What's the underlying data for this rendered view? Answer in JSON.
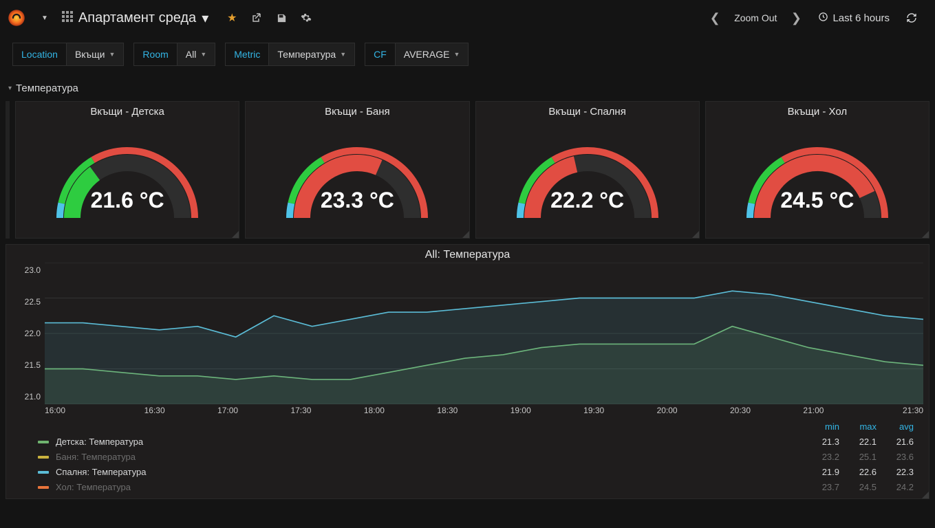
{
  "header": {
    "dashboard_title": "Апартамент среда",
    "zoom_out": "Zoom Out",
    "time_range": "Last 6 hours"
  },
  "variables": [
    {
      "label": "Location",
      "value": "Вкъщи"
    },
    {
      "label": "Room",
      "value": "All"
    },
    {
      "label": "Metric",
      "value": "Температура"
    },
    {
      "label": "CF",
      "value": "AVERAGE"
    }
  ],
  "row_title": "Температура",
  "gauges": [
    {
      "title": "Вкъщи - Детска",
      "value": "21.6 °C",
      "frac": 0.3
    },
    {
      "title": "Вкъщи - Баня",
      "value": "23.3 °C",
      "frac": 0.63
    },
    {
      "title": "Вкъщи - Спалня",
      "value": "22.2 °C",
      "frac": 0.43
    },
    {
      "title": "Вкъщи - Хол",
      "value": "24.5 °C",
      "frac": 0.86
    }
  ],
  "gauge_zones": [
    {
      "from": 0.0,
      "to": 0.07,
      "color": "#4fc3e8"
    },
    {
      "from": 0.07,
      "to": 0.33,
      "color": "#2ecc40"
    },
    {
      "from": 0.33,
      "to": 1.0,
      "color": "#e14d42"
    }
  ],
  "chart_data": {
    "type": "line",
    "title": "All: Температура",
    "xlabel": "",
    "ylabel": "",
    "ylim": [
      21.0,
      23.0
    ],
    "x_ticks": [
      "16:00",
      "16:30",
      "17:00",
      "17:30",
      "18:00",
      "18:30",
      "19:00",
      "19:30",
      "20:00",
      "20:30",
      "21:00",
      "21:30"
    ],
    "y_ticks": [
      "23.0",
      "22.5",
      "22.0",
      "21.5",
      "21.0"
    ],
    "series": [
      {
        "name": "Детска: Температура",
        "color": "#6fb36f",
        "active": true,
        "min": 21.3,
        "max": 22.1,
        "avg": 21.6,
        "values": [
          21.5,
          21.5,
          21.45,
          21.4,
          21.4,
          21.35,
          21.4,
          21.35,
          21.35,
          21.45,
          21.55,
          21.65,
          21.7,
          21.8,
          21.85,
          21.85,
          21.85,
          21.85,
          22.1,
          21.95,
          21.8,
          21.7,
          21.6,
          21.55
        ]
      },
      {
        "name": "Баня: Температура",
        "color": "#c9b23e",
        "active": false,
        "min": 23.2,
        "max": 25.1,
        "avg": 23.6,
        "values": []
      },
      {
        "name": "Спалня: Температура",
        "color": "#5bbcd6",
        "active": true,
        "min": 21.9,
        "max": 22.6,
        "avg": 22.3,
        "values": [
          22.15,
          22.15,
          22.1,
          22.05,
          22.1,
          21.95,
          22.25,
          22.1,
          22.2,
          22.3,
          22.3,
          22.35,
          22.4,
          22.45,
          22.5,
          22.5,
          22.5,
          22.5,
          22.6,
          22.55,
          22.45,
          22.35,
          22.25,
          22.2
        ]
      },
      {
        "name": "Хол: Температура",
        "color": "#e8743b",
        "active": false,
        "min": 23.7,
        "max": 24.5,
        "avg": 24.2,
        "values": []
      }
    ]
  }
}
